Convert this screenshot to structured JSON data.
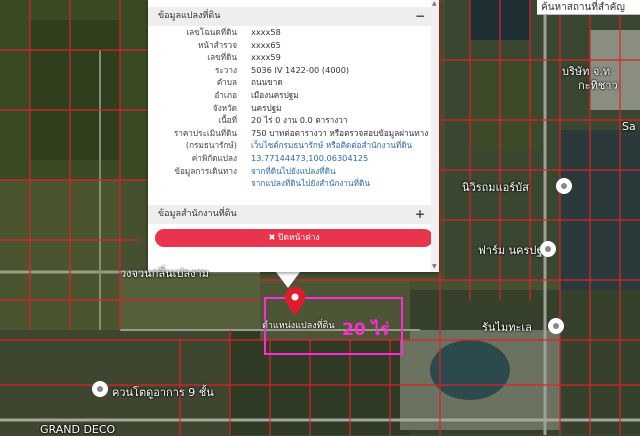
{
  "search": {
    "placeholder": "ค้นหาสถานที่สำคัญ"
  },
  "popup": {
    "section1_title": "ข้อมูลแปลงที่ดิน",
    "section1_symbol": "−",
    "rows": [
      {
        "label": "เลขโฉนดที่ดิน",
        "value": "xxxx58",
        "link": false
      },
      {
        "label": "หน้าสำรวจ",
        "value": "xxxx65",
        "link": false
      },
      {
        "label": "เลขที่ดิน",
        "value": "xxxx59",
        "link": false
      },
      {
        "label": "ระวาง",
        "value": "5036 IV 1422-00 (4000)",
        "link": false
      },
      {
        "label": "ตำบล",
        "value": "ถนนขาด",
        "link": false
      },
      {
        "label": "อำเภอ",
        "value": "เมืองนครปฐม",
        "link": false
      },
      {
        "label": "จังหวัด",
        "value": "นครปฐม",
        "link": false
      },
      {
        "label": "เนื้อที่",
        "value": "20 ไร่ 0 งาน 0.0 ตารางวา",
        "link": false
      },
      {
        "label": "ราคาประเมินที่ดิน",
        "value": "750 บาทต่อตารางวา หรือตรวจสอบข้อมูลผ่านทาง",
        "link": false
      },
      {
        "label": "(กรมธนารักษ์)",
        "value": "เว็บไซต์กรมธนารักษ์ หรือติดต่อสำนักงานที่ดิน",
        "link": true
      },
      {
        "label": "ค่าพิกัดแปลง",
        "value": "13.77144473,100.06304125",
        "link": true
      },
      {
        "label": "ข้อมูลการเดินทาง",
        "value": "จากที่ดินไปยังแปลงที่ดิน",
        "link": true
      },
      {
        "label": "",
        "value": "จากแปลงที่ดินไปยังสำนักงานที่ดิน",
        "link": true
      }
    ],
    "section2_title": "ข้อมูลสำนักงานที่ดิน",
    "section2_symbol": "+",
    "close_label": "✖ ปิดหน้าต่าง"
  },
  "map": {
    "parcel_label": "ตำแหน่งแปลงที่ดิน",
    "area_label": "20 ไร่",
    "places": [
      {
        "name": "บริษัท จ.ท",
        "id": "p1"
      },
      {
        "name": "กะทิชาว",
        "id": "p2"
      },
      {
        "name": "นิวิรถมแอร์บัส",
        "id": "p3"
      },
      {
        "name": "ฟาร์ม นครปฐม",
        "id": "p4"
      },
      {
        "name": "วงจวนกลิ่นเปลงาม",
        "id": "p5"
      },
      {
        "name": "รันไมทะเล",
        "id": "p6"
      },
      {
        "name": "ควนโตดูอาการ 9 ชั้น",
        "id": "p7"
      },
      {
        "name": "GRAND DECO",
        "id": "p8"
      },
      {
        "name": "Sa",
        "id": "p9"
      }
    ]
  },
  "colors": {
    "close_button": "#e8344d",
    "parcel_lines": "#e0202a",
    "pin": "#e21b2c",
    "area_label": "#ff2bd6"
  }
}
